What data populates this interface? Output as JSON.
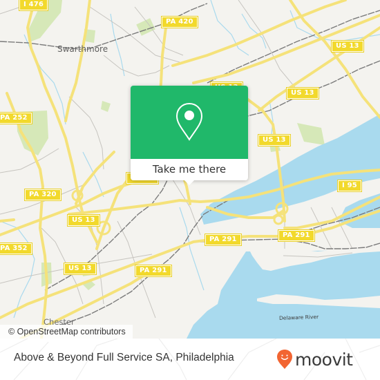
{
  "map": {
    "place_labels": [
      {
        "id": "swarthmore",
        "text": "Swarthmore"
      },
      {
        "id": "chester",
        "text": "Chester"
      }
    ],
    "water_labels": [
      {
        "id": "delaware-river",
        "text": "Delaware River"
      }
    ],
    "road_shields": [
      {
        "id": "i476",
        "text": "I 476"
      },
      {
        "id": "pa420",
        "text": "PA 420"
      },
      {
        "id": "us13-ne",
        "text": "US 13"
      },
      {
        "id": "us13-center-north",
        "text": "US 13"
      },
      {
        "id": "us13-east",
        "text": "US 13"
      },
      {
        "id": "pa252",
        "text": "PA 252"
      },
      {
        "id": "pa320",
        "text": "PA 320"
      },
      {
        "id": "us13-center",
        "text": "US 13"
      },
      {
        "id": "i95",
        "text": "I 95"
      },
      {
        "id": "pa352",
        "text": "PA 352"
      },
      {
        "id": "us13-southwest",
        "text": "US 13"
      },
      {
        "id": "pa291-west",
        "text": "PA 291"
      },
      {
        "id": "pa291-center",
        "text": "PA 291"
      },
      {
        "id": "pa291-east",
        "text": "PA 291"
      }
    ],
    "attribution": "© OpenStreetMap contributors",
    "icons": {
      "popup_pin": "map-pin-icon"
    }
  },
  "popup": {
    "button_label": "Take me there"
  },
  "footer": {
    "title": "Above & Beyond Full Service SA, Philadelphia",
    "brand": "moovit"
  },
  "colors": {
    "land": "#f4f3ef",
    "water": "#a9daee",
    "park": "#d6e8b8",
    "major_road": "#f5e27a",
    "shield_fill": "#f2d92c",
    "popup_green": "#20b86a",
    "moovit_orange": "#f26532",
    "rail": "#7a7a7a"
  }
}
